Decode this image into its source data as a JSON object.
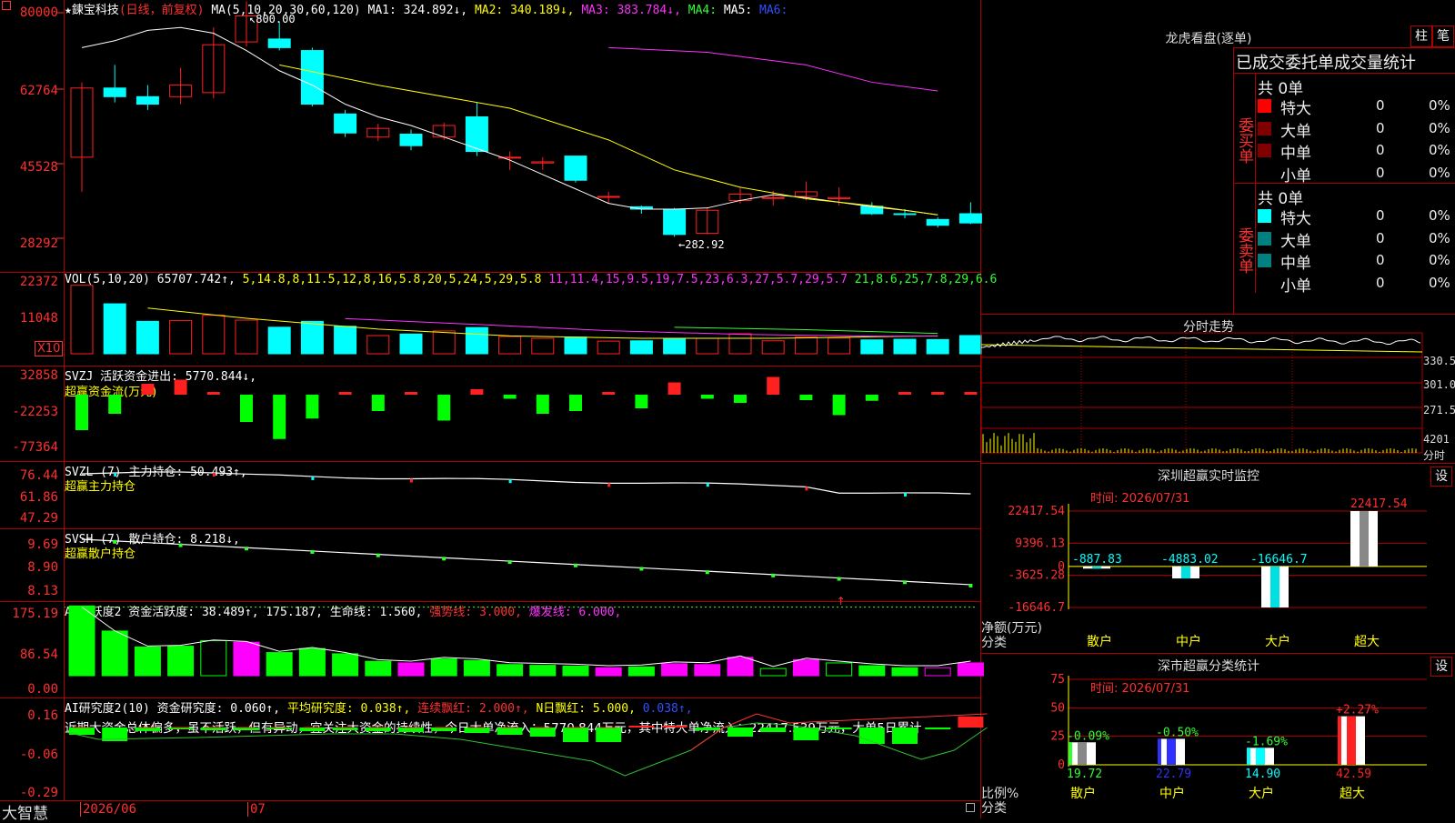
{
  "colors": {
    "up": "#ff2020",
    "down": "#00ffff",
    "grid": "#b00000",
    "label": "#ff3030",
    "ma1": "#ffffff",
    "ma2": "#ffff00",
    "ma3": "#ff30ff",
    "ma4": "#30ff30"
  },
  "header": {
    "star": "★",
    "stock_name": "鍊宝科技",
    "period": "(日线，前复权)",
    "ma_label": "MA(5,10,20,30,60,120)",
    "ma1": "MA1: 324.892↓,",
    "ma2": "MA2: 340.189↓,",
    "ma3": "MA3: 383.784↓,",
    "ma4": "MA4:",
    "ma5": "MA5:",
    "ma6": "MA6:"
  },
  "price_panel": {
    "ticks": [
      "80000",
      "62764",
      "45528",
      "28292"
    ],
    "high_label": "800.00",
    "low_label": "282.92",
    "candles": [
      {
        "o": 170,
        "c": 290,
        "h": 300,
        "l": 110,
        "up": true
      },
      {
        "o": 290,
        "c": 275,
        "h": 330,
        "l": 265,
        "up": false
      },
      {
        "o": 262,
        "c": 275,
        "h": 295,
        "l": 252,
        "up": false
      },
      {
        "o": 275,
        "c": 295,
        "h": 325,
        "l": 262,
        "up": true
      },
      {
        "o": 282,
        "c": 365,
        "h": 395,
        "l": 272,
        "up": true
      },
      {
        "o": 370,
        "c": 415,
        "h": 440,
        "l": 362,
        "up": true
      },
      {
        "o": 360,
        "c": 375,
        "h": 405,
        "l": 355,
        "up": false
      },
      {
        "o": 355,
        "c": 262,
        "h": 360,
        "l": 258,
        "up": false
      },
      {
        "o": 245,
        "c": 212,
        "h": 252,
        "l": 205,
        "up": false
      },
      {
        "o": 205,
        "c": 220,
        "h": 228,
        "l": 198,
        "up": true
      },
      {
        "o": 210,
        "c": 190,
        "h": 218,
        "l": 182,
        "up": false
      },
      {
        "o": 205,
        "c": 225,
        "h": 230,
        "l": 200,
        "up": true
      },
      {
        "o": 240,
        "c": 180,
        "h": 265,
        "l": 172,
        "up": false
      },
      {
        "o": 170,
        "c": 170,
        "h": 180,
        "l": 148,
        "up": true
      },
      {
        "o": 160,
        "c": 162,
        "h": 170,
        "l": 148,
        "up": true
      },
      {
        "o": 172,
        "c": 130,
        "h": 172,
        "l": 126,
        "up": false
      },
      {
        "o": 102,
        "c": 102,
        "h": 110,
        "l": 90,
        "up": true
      },
      {
        "o": 84,
        "c": 80,
        "h": 86,
        "l": 72,
        "up": false
      },
      {
        "o": 80,
        "c": 36,
        "h": 82,
        "l": 32,
        "up": false
      },
      {
        "o": 38,
        "c": 78,
        "h": 82,
        "l": 36,
        "up": true
      },
      {
        "o": 95,
        "c": 106,
        "h": 118,
        "l": 90,
        "up": true
      },
      {
        "o": 100,
        "c": 100,
        "h": 112,
        "l": 86,
        "up": true
      },
      {
        "o": 102,
        "c": 110,
        "h": 128,
        "l": 95,
        "up": true
      },
      {
        "o": 98,
        "c": 100,
        "h": 118,
        "l": 86,
        "up": true
      },
      {
        "o": 85,
        "c": 72,
        "h": 92,
        "l": 70,
        "up": false
      },
      {
        "o": 72,
        "c": 72,
        "h": 80,
        "l": 64,
        "up": false
      },
      {
        "o": 62,
        "c": 52,
        "h": 66,
        "l": 48,
        "up": false
      },
      {
        "o": 72,
        "c": 56,
        "h": 92,
        "l": 54,
        "up": false
      }
    ],
    "ma1": [
      [
        3,
        360
      ],
      [
        4,
        372
      ],
      [
        5,
        390
      ],
      [
        6,
        395
      ],
      [
        7,
        385
      ],
      [
        8,
        355
      ],
      [
        9,
        320
      ],
      [
        10,
        295
      ],
      [
        11,
        262
      ],
      [
        12,
        240
      ],
      [
        13,
        225
      ],
      [
        14,
        205
      ],
      [
        15,
        185
      ],
      [
        16,
        165
      ],
      [
        17,
        140
      ],
      [
        18,
        115
      ],
      [
        19,
        90
      ],
      [
        20,
        80
      ],
      [
        21,
        80
      ],
      [
        22,
        82
      ],
      [
        23,
        95
      ],
      [
        24,
        105
      ],
      [
        25,
        100
      ],
      [
        26,
        92
      ],
      [
        27,
        84
      ],
      [
        28,
        78
      ],
      [
        29,
        70
      ]
    ],
    "ma2": [
      [
        9,
        330
      ],
      [
        12,
        295
      ],
      [
        16,
        255
      ],
      [
        19,
        200
      ],
      [
        21,
        148
      ],
      [
        23,
        118
      ],
      [
        25,
        98
      ],
      [
        27,
        86
      ],
      [
        29,
        70
      ]
    ],
    "ma3": [
      [
        19,
        360
      ],
      [
        22,
        352
      ],
      [
        25,
        330
      ],
      [
        27,
        300
      ],
      [
        29,
        285
      ]
    ]
  },
  "vol_panel": {
    "info_label": "VOL(5,10,20)",
    "info_value": "65707.742↑,",
    "ma1": [
      [
        5,
        14.8
      ],
      [
        8,
        11.5
      ],
      [
        12,
        8.0
      ],
      [
        16,
        5.8
      ],
      [
        20,
        5.0
      ],
      [
        24,
        5.0
      ],
      [
        29,
        5.8
      ]
    ],
    "ma2": [
      [
        11,
        11.4
      ],
      [
        15,
        9.5
      ],
      [
        19,
        7.5
      ],
      [
        23,
        6.3
      ],
      [
        27,
        5.7
      ],
      [
        29,
        5.7
      ]
    ],
    "ma3": [
      [
        21,
        8.6
      ],
      [
        25,
        7.8
      ],
      [
        29,
        6.6
      ]
    ],
    "ticks": [
      "22372",
      "11048"
    ],
    "unit": "X10",
    "bars": [
      22.2,
      16.2,
      10.5,
      10.8,
      12.5,
      10.9,
      8.6,
      10.5,
      8.9,
      5.9,
      6.4,
      7.4,
      8.5,
      5.6,
      5.0,
      5.4,
      4.1,
      4.2,
      5.0,
      5.0,
      6.5,
      4.2,
      5.4,
      5.1,
      4.5,
      4.7,
      4.6,
      5.9
    ]
  },
  "svzj_panel": {
    "info": "SVZJ  活跃资金进出: 5770.844↓,",
    "sub": "超赢资金流(万元)",
    "ticks": [
      "32858",
      "-22253",
      "-77364"
    ],
    "bars": [
      -52000,
      -28000,
      16000,
      22000,
      4000,
      -40000,
      -65000,
      -35000,
      3000,
      -24000,
      2000,
      -38000,
      8000,
      -6000,
      -28000,
      -24000,
      2000,
      -20000,
      18000,
      -6000,
      -12000,
      26000,
      -8000,
      -30000,
      -9000,
      3000,
      4000,
      0
    ]
  },
  "svzl_panel": {
    "info": "SVZL (7) 主力持仓: 50.493↑,",
    "sub": "超赢主力持仓",
    "ticks": [
      "76.44",
      "61.86",
      "47.29"
    ]
  },
  "svsh_panel": {
    "info": "SVSH (7) 散户持仓: 8.218↓,",
    "sub": "超赢散户持仓",
    "ticks": [
      "9.69",
      "8.90",
      "8.13"
    ]
  },
  "ai_panel": {
    "info_a": "AI活跃度2 资金活跃度: 38.489↑, 175.187, 生命线: 1.560,",
    "info_b": "强势线: 3.000,",
    "info_c": "爆发线: 6.000,",
    "ticks": [
      "175.19",
      "86.54",
      "0.00"
    ],
    "bars": [
      175,
      112,
      72,
      74,
      88,
      84,
      58,
      68,
      55,
      36,
      32,
      42,
      38,
      28,
      26,
      24,
      20,
      22,
      30,
      28,
      46,
      18,
      40,
      32,
      25,
      20,
      20,
      32
    ],
    "types": [
      "g",
      "g",
      "g",
      "g",
      "go",
      "m",
      "g",
      "g",
      "g",
      "g",
      "m",
      "g",
      "g",
      "g",
      "g",
      "g",
      "m",
      "g",
      "m",
      "m",
      "m",
      "go",
      "m",
      "go",
      "g",
      "g",
      "mo",
      "m"
    ]
  },
  "research_panel": {
    "info_a": "AI研究度2(10) 资金研究度: 0.060↑,",
    "info_b": "平均研究度: 0.038↑,",
    "info_c": "连续飘红: 2.000↑,",
    "info_d": "N日飘红: 5.000,",
    "info_e": "0.038↑,",
    "text": "近期大资金总体偏多，虽不活跃，但有异动，宜关注大资金的持续性，今日大单净流入：5770.844万元，其中特大单净流入：22417.539万元，大单5日累计",
    "ticks": [
      "0.16",
      "-0.06",
      "-0.29"
    ]
  },
  "bottom": {
    "brand": "大智慧",
    "date1": "2026/06",
    "date2": "07"
  },
  "dragon": {
    "title": "龙虎看盘(逐单)",
    "btn1": "柱",
    "btn2": "笔",
    "tab_header": "已成交委托单成交量统计",
    "buy_total": "共 0单",
    "buy_label": "委买单",
    "sell_total": "共 0单",
    "sell_label": "委卖单",
    "rows": [
      "特大",
      "大单",
      "中单",
      "小单"
    ],
    "buy_colors": [
      "#ff0000",
      "#800000",
      "#800000",
      ""
    ],
    "sell_colors": [
      "#00ffff",
      "#008080",
      "#008080",
      ""
    ],
    "zero": "0",
    "pct": "0%"
  },
  "intraday": {
    "title": "分时走势",
    "right_ticks": [
      "330.5",
      "301.0",
      "271.5",
      "4201"
    ],
    "unit": "分时"
  },
  "monitor": {
    "title": "深圳超赢实时监控",
    "set": "设",
    "time": "时间: 2026/07/31",
    "ticks": [
      "22417.54",
      "9396.13",
      "0",
      "-3625.28",
      "-16646.7"
    ],
    "ylabel_a": "净额(万元)",
    "ylabel_b": "分类",
    "cats": [
      "散户",
      "中户",
      "大户",
      "超大"
    ],
    "values": [
      -887.83,
      -4883.02,
      -16646.7,
      22417.54
    ],
    "value_labels": [
      "-887.83",
      "-4883.02",
      "-16646.7",
      "22417.54"
    ]
  },
  "classify": {
    "title": "深市超赢分类统计",
    "set": "设",
    "time": "时间: 2026/07/31",
    "ticks": [
      "75",
      "50",
      "25",
      "0"
    ],
    "ylabel_a": "比例%",
    "ylabel_b": "分类",
    "cats": [
      "散户",
      "中户",
      "大户",
      "超大"
    ],
    "values": [
      19.72,
      22.79,
      14.9,
      42.59
    ],
    "value_labels": [
      "19.72",
      "22.79",
      "14.90",
      "42.59"
    ],
    "changes": [
      "-0.09%",
      "-0.50%",
      "-1.69%",
      "+2.27%"
    ],
    "colors": [
      "#30ff30",
      "#3030ff",
      "#00ffff",
      "#ff2020"
    ]
  }
}
